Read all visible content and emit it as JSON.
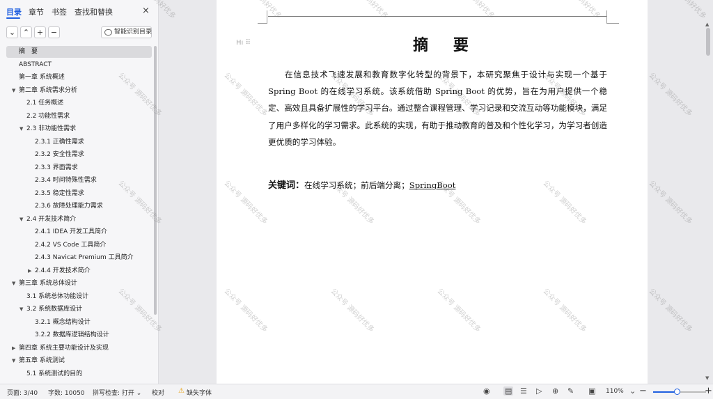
{
  "nav": {
    "tabs": [
      "目录",
      "章节",
      "书签",
      "查找和替换"
    ],
    "close_icon": "×",
    "toolbar": {
      "collapse": "⌄",
      "expand": "⌃",
      "add": "+",
      "remove": "−",
      "smart_label": "智能识别目录"
    },
    "toc": [
      {
        "label": "摘　要",
        "selected": true
      },
      {
        "label": "ABSTRACT"
      },
      {
        "label": "第一章  系统概述"
      },
      {
        "label": "第二章  系统需求分析",
        "arrow": "▼"
      },
      {
        "label": "2.1  任务概述"
      },
      {
        "label": "2.2  功能性需求"
      },
      {
        "label": "2.3  非功能性需求",
        "arrow": "▼"
      },
      {
        "label": "2.3.1 正确性需求"
      },
      {
        "label": "2.3.2 安全性需求"
      },
      {
        "label": "2.3.3 界面需求"
      },
      {
        "label": "2.3.4 时间特殊性需求"
      },
      {
        "label": "2.3.5 稳定性需求"
      },
      {
        "label": "2.3.6 故障处理能力需求"
      },
      {
        "label": "2.4  开发技术简介",
        "arrow": "▼"
      },
      {
        "label": "2.4.1 IDEA  开发工具简介"
      },
      {
        "label": "2.4.2 VS Code 工具简介"
      },
      {
        "label": "2.4.3 Navicat Premium 工具简介"
      },
      {
        "label": "2.4.4  开发技术简介",
        "arrow": "▶"
      },
      {
        "label": "第三章  系统总体设计",
        "arrow": "▼"
      },
      {
        "label": "3.1  系统总体功能设计"
      },
      {
        "label": "3.2  系统数据库设计",
        "arrow": "▼"
      },
      {
        "label": "3.2.1  概念结构设计"
      },
      {
        "label": "3.2.2  数据库逻辑结构设计"
      },
      {
        "label": "第四章  系统主要功能设计及实现",
        "arrow": "▶"
      },
      {
        "label": "第五章  系统测试",
        "arrow": "▼"
      },
      {
        "label": "5.1  系统测试的目的"
      }
    ]
  },
  "document": {
    "heading_handle": "Hı ⠿",
    "title": "摘 要",
    "abstract": "在信息技术飞速发展和教育数字化转型的背景下，本研究聚焦于设计与实现一个基于Spring Boot 的在线学习系统。该系统借助 Spring Boot 的优势，旨在为用户提供一个稳定、高效且具备扩展性的学习平台。通过整合课程管理、学习记录和交流互动等功能模块，满足了用户多样化的学习需求。此系统的实现，有助于推动教育的普及和个性化学习，为学习者创造更优质的学习体验。",
    "keywords_label": "关键词：",
    "keywords_text": "在线学习系统；前后端分离；",
    "keywords_last": "SpringBoot",
    "watermark": "公众号 源码好优多"
  },
  "status": {
    "page": "页面: 3/40",
    "words": "字数: 10050",
    "spell": "拼写检查: 打开 ⌄",
    "proof": "校对",
    "missing_font": "缺失字体",
    "zoom": "110%",
    "zoom_level": 0.45
  }
}
